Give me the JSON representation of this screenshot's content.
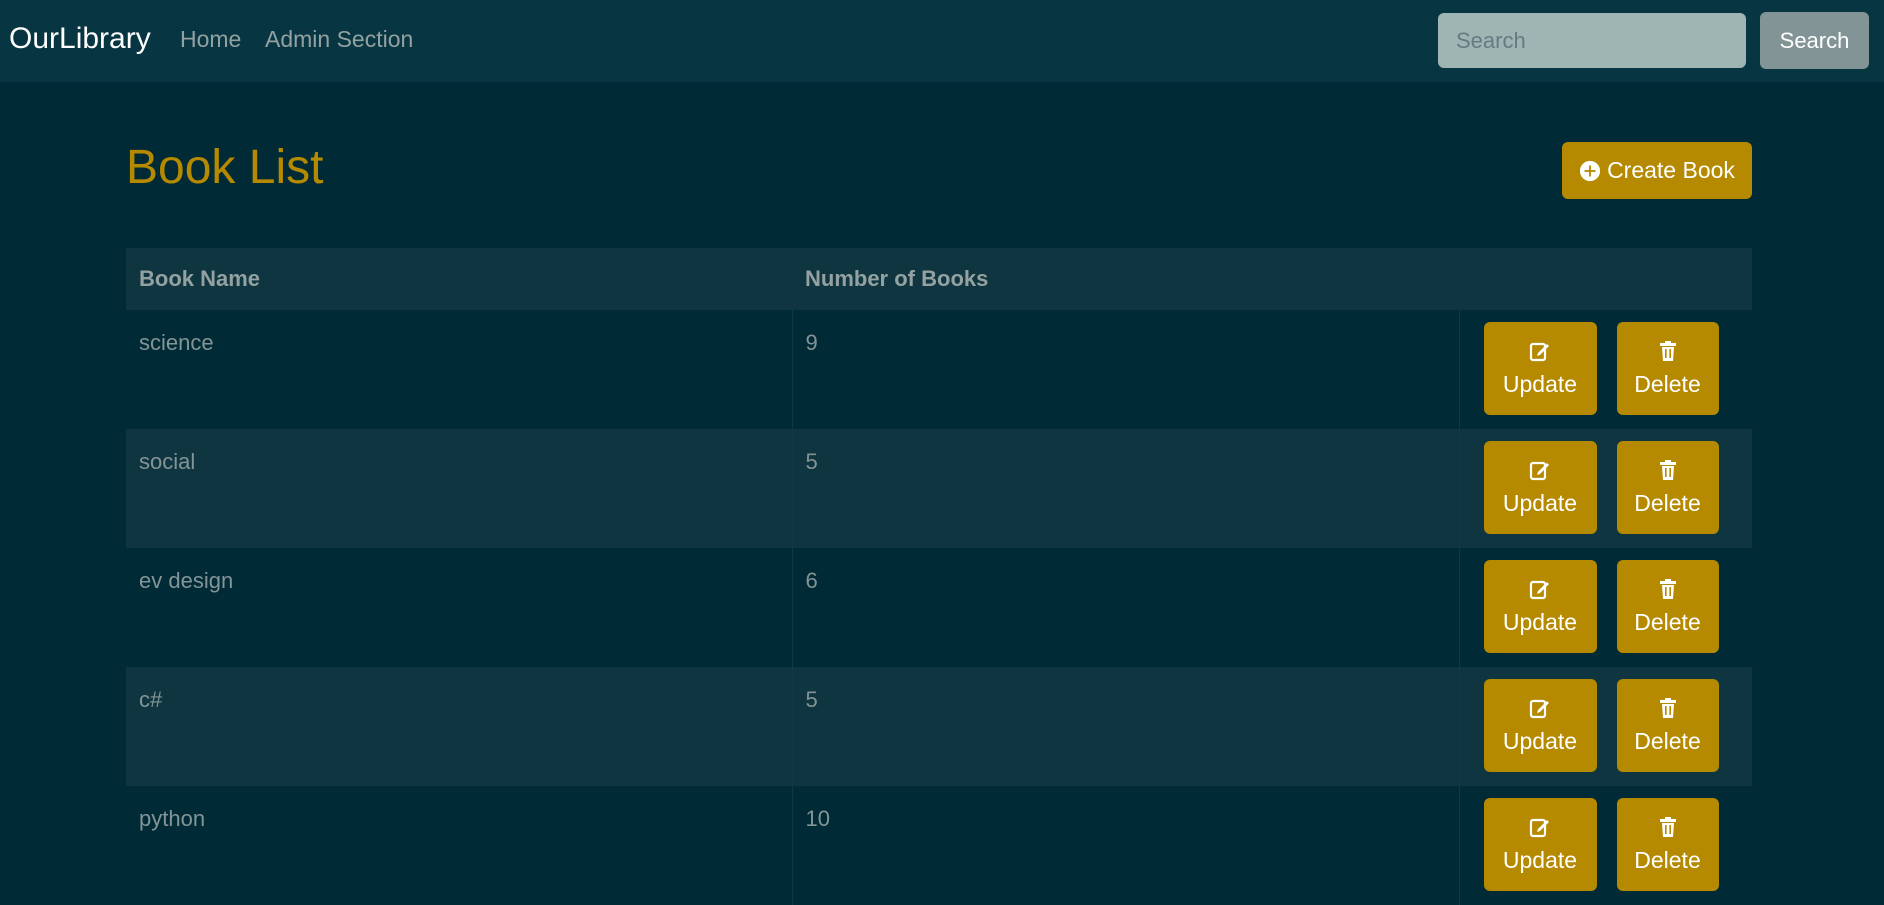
{
  "navbar": {
    "brand": "OurLibrary",
    "links": [
      "Home",
      "Admin Section"
    ],
    "search_placeholder": "Search",
    "search_button": "Search"
  },
  "page": {
    "title": "Book List",
    "create_button": "Create Book"
  },
  "table": {
    "headers": [
      "Book Name",
      "Number of Books",
      ""
    ],
    "rows": [
      {
        "name": "science",
        "count": "9"
      },
      {
        "name": "social",
        "count": "5"
      },
      {
        "name": "ev design",
        "count": "6"
      },
      {
        "name": "c#",
        "count": "5"
      },
      {
        "name": "python",
        "count": "10"
      }
    ],
    "update_label": "Update",
    "delete_label": "Delete"
  },
  "icons": {
    "create": "plus-circle-icon",
    "update": "edit-icon",
    "delete": "trash-icon"
  },
  "colors": {
    "background": "#002b36",
    "navbar": "#073642",
    "accent": "#b58900",
    "text": "#839496"
  }
}
